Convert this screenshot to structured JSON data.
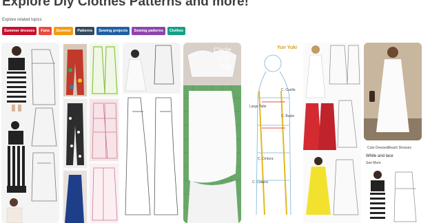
{
  "header": {
    "title": "Explore Diy Clothes Patterns and more!",
    "related_label": "Explore related topics"
  },
  "topics": [
    {
      "label": "Summer dresses",
      "color": "#c8102e"
    },
    {
      "label": "Fans",
      "color": "#e84c3d"
    },
    {
      "label": "Summer",
      "color": "#f39c12"
    },
    {
      "label": "Patterns",
      "color": "#34495e"
    },
    {
      "label": "Sewing projects",
      "color": "#1f5fa3"
    },
    {
      "label": "Sewing patterns",
      "color": "#8e44ad"
    },
    {
      "label": "Clothes",
      "color": "#16a085"
    }
  ],
  "pins": {
    "circle_top_title_line1": "Circle",
    "circle_top_title_line2": "Knit",
    "circle_top_title_line3": "Top",
    "yun_yuki_label": "Yun Yuki",
    "pattern_labels": {
      "a": "C. Cuello",
      "b": "Largo Talle",
      "c": "C. Busto",
      "d": "C. Cintura",
      "e": "C. Cadera"
    },
    "white_lace_board_a": "Cute Dresses",
    "white_lace_board_b": "Beach Dresses",
    "white_lace_title": "White and lace",
    "white_lace_more": "See More"
  }
}
